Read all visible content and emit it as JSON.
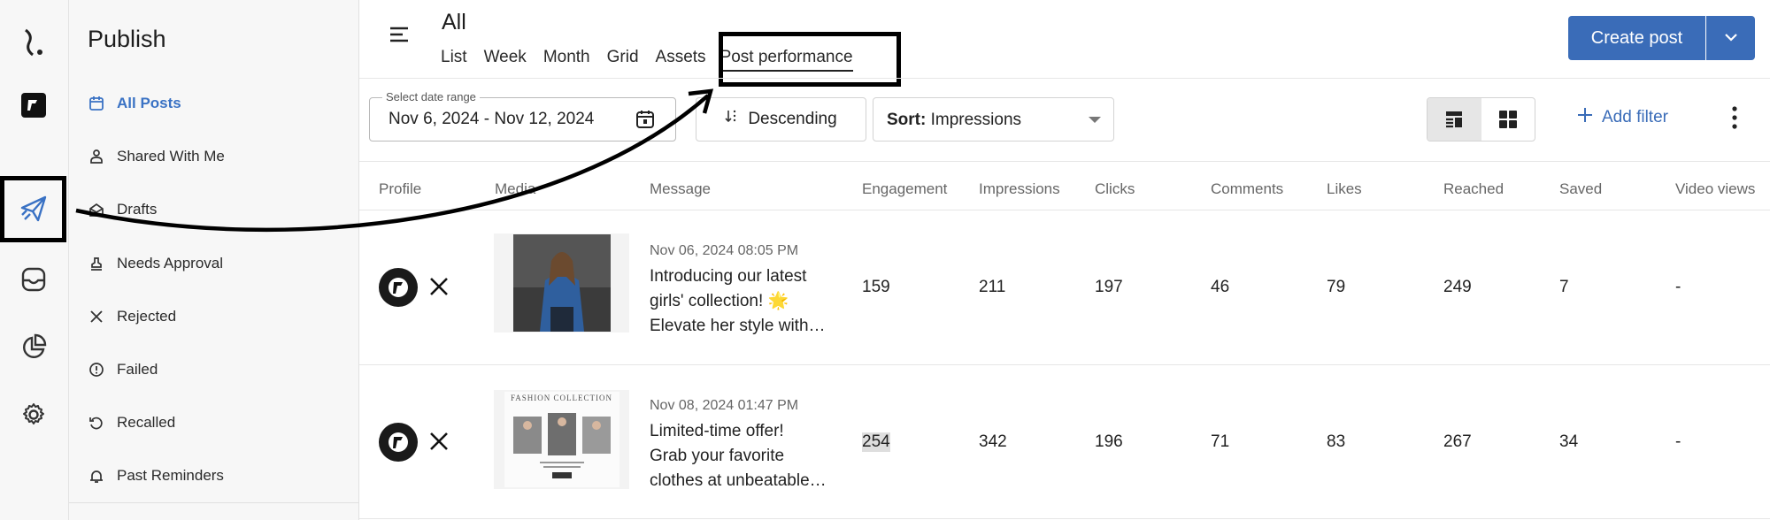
{
  "sidebar": {
    "title": "Publish",
    "items": [
      {
        "label": "All Posts"
      },
      {
        "label": "Shared With Me"
      },
      {
        "label": "Drafts"
      },
      {
        "label": "Needs Approval"
      },
      {
        "label": "Rejected"
      },
      {
        "label": "Failed"
      },
      {
        "label": "Recalled"
      },
      {
        "label": "Past Reminders"
      }
    ]
  },
  "header": {
    "title": "All",
    "tabs": [
      {
        "label": "List"
      },
      {
        "label": "Week"
      },
      {
        "label": "Month"
      },
      {
        "label": "Grid"
      },
      {
        "label": "Assets"
      },
      {
        "label": "Post performance"
      }
    ],
    "create_label": "Create post"
  },
  "toolbar": {
    "date_label": "Select date range",
    "date_value": "Nov 6, 2024 - Nov 12, 2024",
    "sort_direction": "Descending",
    "sort_prefix": "Sort:",
    "sort_value": "Impressions",
    "add_filter": "Add filter"
  },
  "table": {
    "columns": [
      "Profile",
      "Media",
      "Message",
      "Engagement",
      "Impressions",
      "Clicks",
      "Comments",
      "Likes",
      "Reached",
      "Saved",
      "Video views"
    ],
    "rows": [
      {
        "date": "Nov 06, 2024 08:05 PM",
        "message_lines": [
          "Introducing our latest",
          "girls' collection! 🌟",
          "Elevate her style with…"
        ],
        "engagement": "159",
        "impressions": "211",
        "clicks": "197",
        "comments": "46",
        "likes": "79",
        "reached": "249",
        "saved": "7",
        "video_views": "-"
      },
      {
        "date": "Nov 08, 2024 01:47 PM",
        "message_lines": [
          "Limited-time offer!",
          "Grab your favorite",
          "clothes at unbeatable…"
        ],
        "engagement": "254",
        "impressions": "342",
        "clicks": "196",
        "comments": "71",
        "likes": "83",
        "reached": "267",
        "saved": "34",
        "video_views": "-"
      }
    ],
    "thumb2_caption": "FASHION COLLECTION"
  },
  "colors": {
    "accent": "#3a6cb8",
    "active_nav": "#3a72c4"
  },
  "icons": [
    "logo-icon",
    "brand-icon",
    "paper-plane-icon",
    "inbox-icon",
    "pie-chart-icon",
    "gear-icon",
    "calendar-icon",
    "menu-icon",
    "chevron-down-icon",
    "sort-icon",
    "list-view-icon",
    "grid-view-icon",
    "plus-icon",
    "more-icon",
    "x-logo-icon"
  ]
}
